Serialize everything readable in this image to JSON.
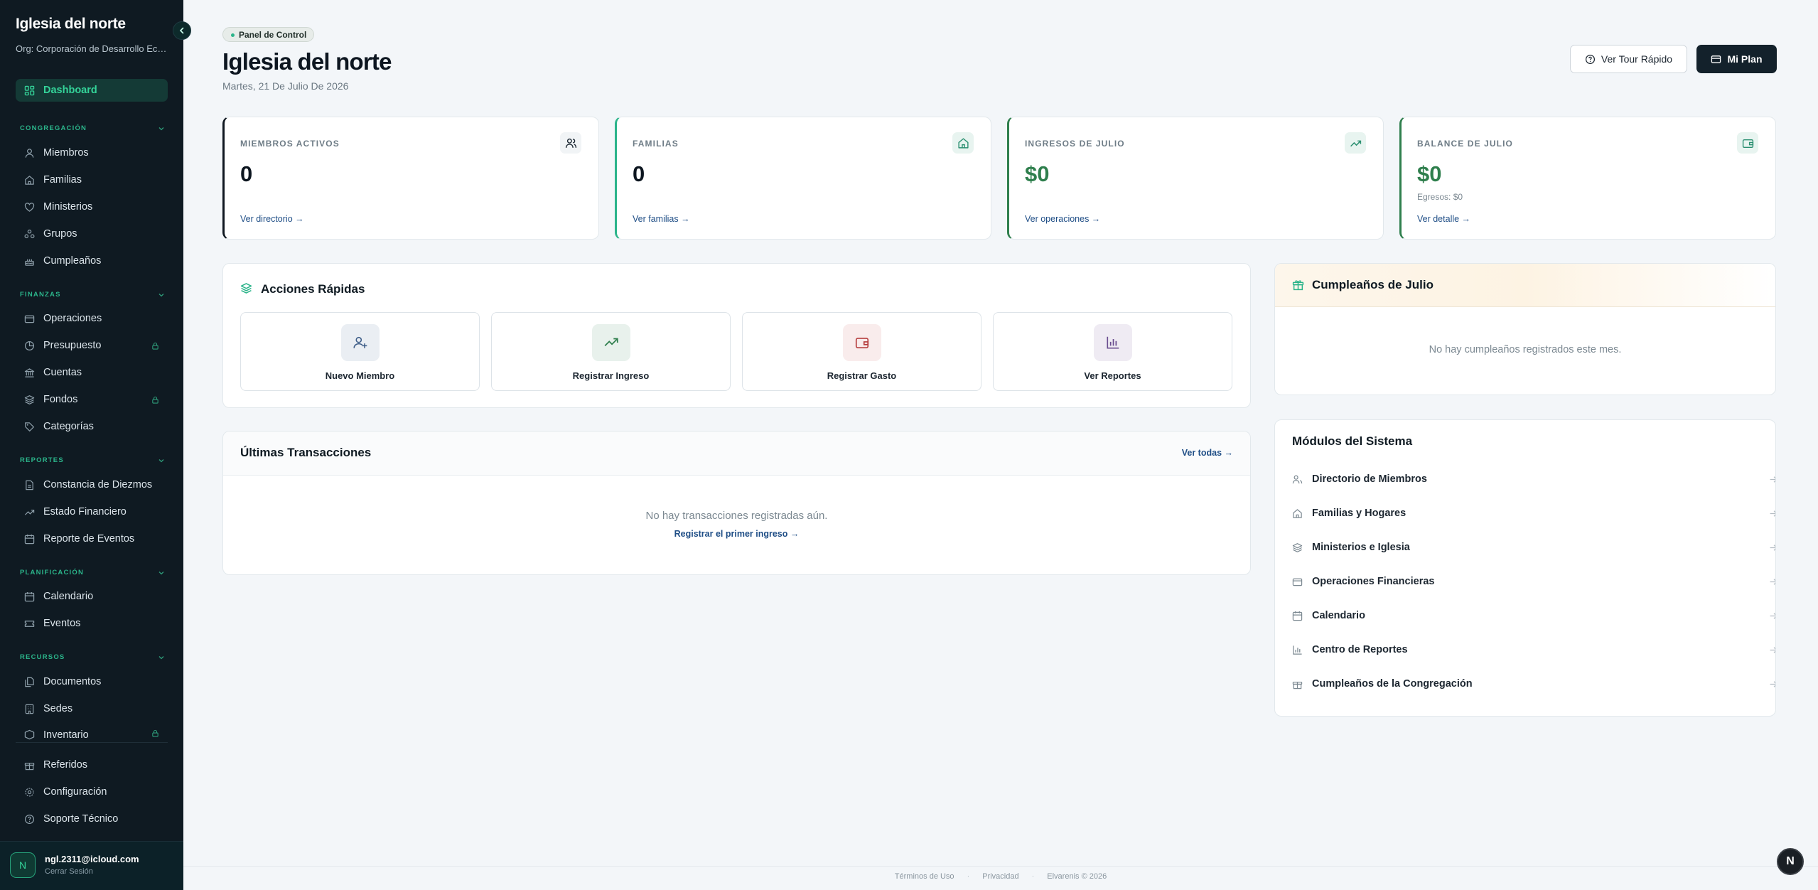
{
  "sidebar": {
    "title": "Iglesia del norte",
    "org": "Org: Corporación de Desarrollo Eclesial",
    "active_item": "Dashboard",
    "sections": {
      "congregacion": "CONGREGACIÓN",
      "finanzas": "FINANZAS",
      "reportes": "REPORTES",
      "planificacion": "PLANIFICACIÓN",
      "recursos": "RECURSOS"
    },
    "items": {
      "miembros": "Miembros",
      "familias": "Familias",
      "ministerios": "Ministerios",
      "grupos": "Grupos",
      "cumpleanos": "Cumpleaños",
      "operaciones": "Operaciones",
      "presupuesto": "Presupuesto",
      "cuentas": "Cuentas",
      "fondos": "Fondos",
      "categorias": "Categorías",
      "constancia": "Constancia de Diezmos",
      "estado": "Estado Financiero",
      "reporte_eventos": "Reporte de Eventos",
      "calendario": "Calendario",
      "eventos": "Eventos",
      "documentos": "Documentos",
      "sedes": "Sedes",
      "inventario": "Inventario",
      "referidos": "Referidos",
      "configuracion": "Configuración",
      "soporte": "Soporte Técnico"
    },
    "user": {
      "initial": "N",
      "email": "ngl.2311@icloud.com",
      "logout": "Cerrar Sesión"
    }
  },
  "header": {
    "badge": "Panel de Control",
    "title": "Iglesia del norte",
    "date": "Martes, 21 De Julio De 2026",
    "tour_button": "Ver Tour Rápido",
    "plan_button": "Mi Plan"
  },
  "stats": [
    {
      "label": "MIEMBROS ACTIVOS",
      "value": "0",
      "link": "Ver directorio →",
      "sub": ""
    },
    {
      "label": "FAMILIAS",
      "value": "0",
      "link": "Ver familias →",
      "sub": ""
    },
    {
      "label": "INGRESOS DE JULIO",
      "value": "$0",
      "link": "Ver operaciones →",
      "sub": ""
    },
    {
      "label": "BALANCE DE JULIO",
      "value": "$0",
      "link": "Ver detalle →",
      "sub": "Egresos: $0"
    }
  ],
  "quick_actions": {
    "title": "Acciones Rápidas",
    "items": [
      "Nuevo Miembro",
      "Registrar Ingreso",
      "Registrar Gasto",
      "Ver Reportes"
    ]
  },
  "transactions": {
    "title": "Últimas Transacciones",
    "view_all": "Ver todas →",
    "empty": "No hay transacciones registradas aún.",
    "cta": "Registrar el primer ingreso →"
  },
  "birthdays": {
    "title": "Cumpleaños de Julio",
    "empty": "No hay cumpleaños registrados este mes."
  },
  "modules": {
    "title": "Módulos del Sistema",
    "items": [
      "Directorio de Miembros",
      "Familias y Hogares",
      "Ministerios e Iglesia",
      "Operaciones Financieras",
      "Calendario",
      "Centro de Reportes",
      "Cumpleaños de la Congregación"
    ]
  },
  "footer": {
    "terms": "Términos de Uso",
    "privacy": "Privacidad",
    "copyright": "Elvarenis © 2026",
    "separator": "·"
  },
  "colors": {
    "sidebar_bg": "#0f1a22",
    "accent_green": "#34d399",
    "money_green": "#2f7f4d",
    "link_blue": "#1f4e86"
  }
}
